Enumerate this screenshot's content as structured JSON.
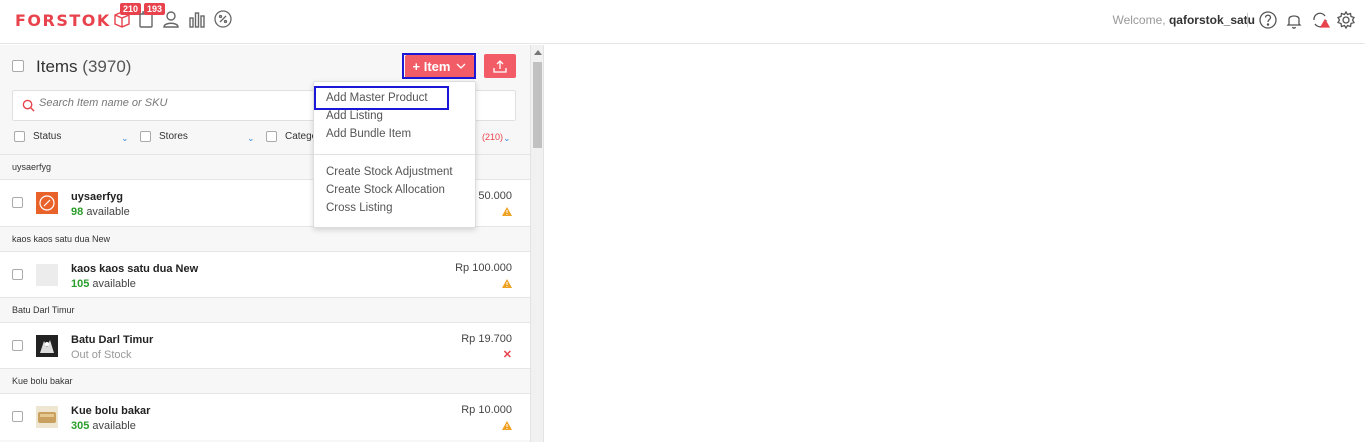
{
  "app": {
    "logo": "FORSTOK"
  },
  "nav": {
    "items_badge": "210",
    "orders_badge": "193"
  },
  "header": {
    "welcome_prefix": "Welcome,",
    "username": "qaforstok_satu"
  },
  "items_panel": {
    "title": "Items",
    "count": "(3970)",
    "add_button_label": "+ Item",
    "search_placeholder": "Search Item name or SKU",
    "filters": {
      "status": "Status",
      "stores": "Stores",
      "category": "Catego",
      "count": "(210)"
    }
  },
  "dropdown": {
    "items": [
      "Add Master Product",
      "Add Listing",
      "Add Bundle Item",
      "Create Stock Adjustment",
      "Create Stock Allocation",
      "Cross Listing"
    ]
  },
  "groups": [
    {
      "header": "uysaerfyg",
      "name": "uysaerfyg",
      "stock_num": "98",
      "stock_label": "available",
      "price": "50.000"
    },
    {
      "header": "kaos kaos satu dua New",
      "name": "kaos kaos satu dua New",
      "stock_num": "105",
      "stock_label": "available",
      "price": "Rp 100.000"
    },
    {
      "header": "Batu Darl Timur",
      "name": "Batu Darl Timur",
      "stock_label": "Out of Stock",
      "price": "Rp 19.700"
    },
    {
      "header": "Kue bolu bakar",
      "name": "Kue bolu bakar",
      "stock_num": "305",
      "stock_label": "available",
      "price": "Rp 10.000"
    }
  ],
  "colors": {
    "brand": "#e8434d",
    "focus": "#1a17d6",
    "available": "#2a9d2a",
    "warning": "#f0a020"
  }
}
